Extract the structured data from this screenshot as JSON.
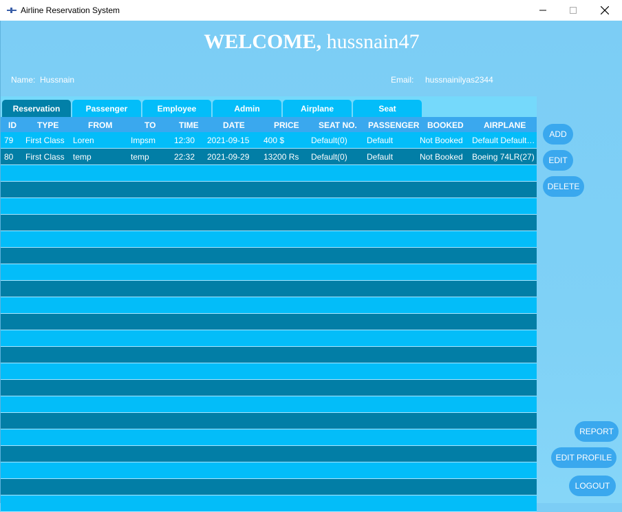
{
  "window": {
    "title": "Airline Reservation System",
    "icon": "airplane-app-icon",
    "controls": {
      "minimize": "minimize-icon",
      "maximize": "maximize-icon",
      "close": "close-icon"
    }
  },
  "header": {
    "welcome_label": "WELCOME,",
    "username": "hussnain47"
  },
  "user_info": {
    "name_label": "Name:",
    "name_value": "Hussnain",
    "email_label": "Email:",
    "email_value": "hussnainilyas2344"
  },
  "tabs": [
    {
      "label": "Reservation",
      "active": true
    },
    {
      "label": "Passenger",
      "active": false
    },
    {
      "label": "Employee",
      "active": false
    },
    {
      "label": "Admin",
      "active": false
    },
    {
      "label": "Airplane",
      "active": false
    },
    {
      "label": "Seat",
      "active": false
    }
  ],
  "table": {
    "columns": [
      "ID",
      "TYPE",
      "FROM",
      "TO",
      "TIME",
      "DATE",
      "PRICE",
      "SEAT NO.",
      "PASSENGER",
      "BOOKED",
      "AIRPLANE"
    ],
    "rows": [
      [
        "79",
        "First Class",
        "Loren",
        "Impsm",
        "12:30",
        "2021-09-15",
        "400 $",
        "Default(0)",
        "Default",
        "Not Booked",
        "Default Default…"
      ],
      [
        "80",
        "First Class",
        "temp",
        "temp",
        "22:32",
        "2021-09-29",
        "13200 Rs",
        "Default(0)",
        "Default",
        "Not Booked",
        "Boeing 74LR(27)"
      ]
    ]
  },
  "actions": {
    "add": "ADD",
    "edit": "EDIT",
    "delete": "DELETE",
    "report": "REPORT",
    "edit_profile": "EDIT PROFILE",
    "logout": "LOGOUT"
  },
  "colors": {
    "background": "#7ccdf5",
    "tab_active": "#0280a8",
    "tab_inactive": "#03bdf9",
    "row_light": "#03bdf9",
    "row_dark": "#027ea6",
    "button": "#3aa8ee"
  }
}
